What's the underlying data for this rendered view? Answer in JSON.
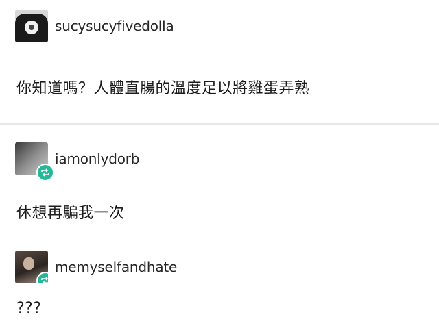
{
  "posts": [
    {
      "username": "sucysucyfivedolla",
      "text": "你知道嗎？人體直腸的溫度足以將雞蛋弄熟",
      "avatar_icon": "user-avatar-icon",
      "reblog": false
    },
    {
      "username": "iamonlydorb",
      "text": "休想再騙我一次",
      "avatar_icon": "user-avatar-icon",
      "reblog": true
    },
    {
      "username": "memyselfandhate",
      "text": "???",
      "avatar_icon": "user-avatar-icon",
      "reblog": true
    }
  ],
  "colors": {
    "reblog_badge": "#27b89a",
    "divider": "#e9e9e9",
    "text": "#1c1c1c"
  }
}
